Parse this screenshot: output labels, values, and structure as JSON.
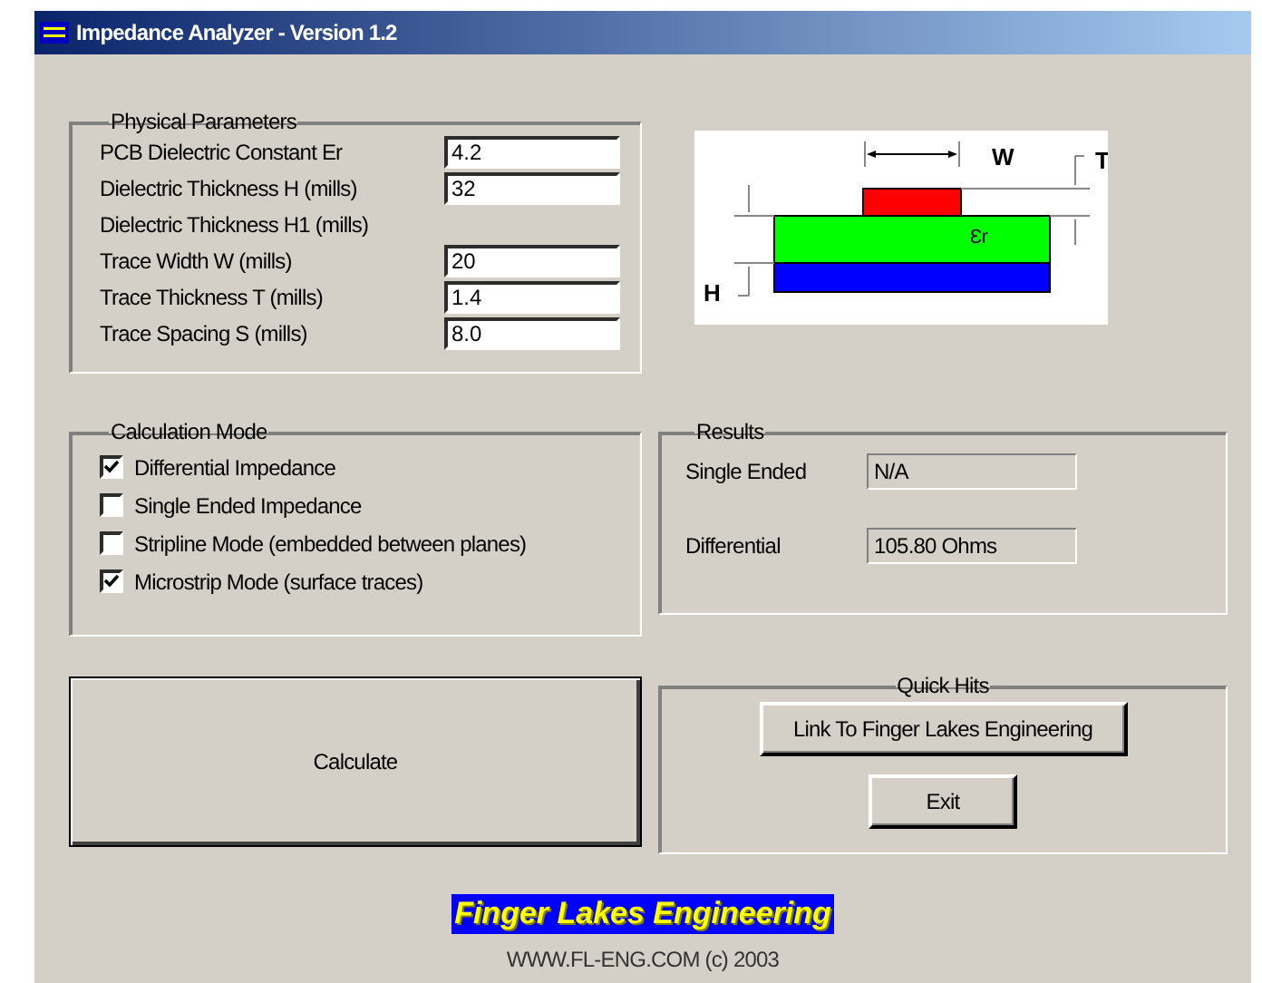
{
  "window": {
    "title": "Impedance Analyzer - Version 1.2"
  },
  "physical_parameters": {
    "title": "Physical Parameters",
    "rows": [
      {
        "label": "PCB Dielectric Constant Er",
        "value": "4.2"
      },
      {
        "label": "Dielectric Thickness H (mills)",
        "value": "32"
      },
      {
        "label": "Dielectric Thickness H1 (mills)"
      },
      {
        "label": "Trace Width W (mills)",
        "value": "20"
      },
      {
        "label": "Trace Thickness T (mills)",
        "value": "1.4"
      },
      {
        "label": "Trace Spacing S (mills)",
        "value": "8.0"
      }
    ]
  },
  "diagram": {
    "labels": {
      "width": "W",
      "thickness": "T",
      "height": "H",
      "dielectric": "Ɛr"
    }
  },
  "calculation_mode": {
    "title": "Calculation Mode",
    "options": [
      {
        "label": "Differential Impedance",
        "checked": true
      },
      {
        "label": "Single Ended Impedance",
        "checked": false
      },
      {
        "label": "Stripline Mode (embedded between planes)",
        "checked": false
      },
      {
        "label": "Microstrip Mode (surface traces)",
        "checked": true
      }
    ]
  },
  "results": {
    "title": "Results",
    "rows": [
      {
        "label": "Single Ended",
        "value": "N/A"
      },
      {
        "label": "Differential",
        "value": "105.80 Ohms"
      }
    ]
  },
  "calculate_button": "Calculate",
  "quick_hits": {
    "title": "Quick Hits",
    "buttons": [
      "Link To Finger Lakes Engineering",
      "Exit"
    ]
  },
  "footer": {
    "logo": "Finger Lakes Engineering",
    "credit": "WWW.FL-ENG.COM (c) 2003"
  }
}
